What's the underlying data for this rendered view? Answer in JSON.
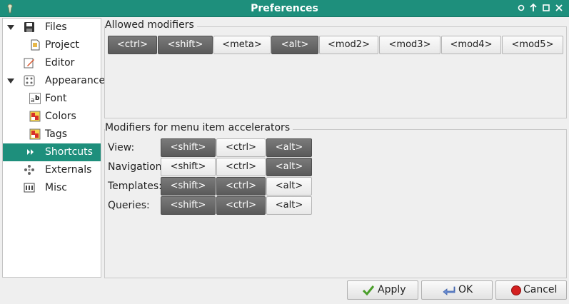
{
  "window": {
    "title": "Preferences",
    "controls": [
      "circle-icon",
      "up-arrow-icon",
      "maximize-icon",
      "close-icon"
    ]
  },
  "sidebar": {
    "items": [
      {
        "label": "Files",
        "icon": "floppy-disk-icon",
        "expanded": true
      },
      {
        "label": "Project",
        "icon": "project-document-icon"
      },
      {
        "label": "Editor",
        "icon": "pencil-edit-icon"
      },
      {
        "label": "Appearance",
        "icon": "appearance-icon",
        "expanded": true
      },
      {
        "label": "Font",
        "icon": "font-icon"
      },
      {
        "label": "Colors",
        "icon": "colors-icon"
      },
      {
        "label": "Tags",
        "icon": "tags-icon"
      },
      {
        "label": "Shortcuts",
        "icon": "fast-forward-icon",
        "selected": true
      },
      {
        "label": "Externals",
        "icon": "externals-icon"
      },
      {
        "label": "Misc",
        "icon": "misc-icon"
      }
    ]
  },
  "allowed_modifiers": {
    "title": "Allowed modifiers",
    "buttons": [
      {
        "label": "<ctrl>",
        "checked": true
      },
      {
        "label": "<shift>",
        "checked": true
      },
      {
        "label": "<meta>",
        "checked": false
      },
      {
        "label": "<alt>",
        "checked": true
      },
      {
        "label": "<mod2>",
        "checked": false
      },
      {
        "label": "<mod3>",
        "checked": false
      },
      {
        "label": "<mod4>",
        "checked": false
      },
      {
        "label": "<mod5>",
        "checked": false
      }
    ]
  },
  "accelerators": {
    "title": "Modifiers for menu item accelerators",
    "rows": [
      {
        "label": "View:",
        "buttons": [
          {
            "label": "<shift>",
            "checked": true
          },
          {
            "label": "<ctrl>",
            "checked": false
          },
          {
            "label": "<alt>",
            "checked": true
          }
        ]
      },
      {
        "label": "Navigation:",
        "buttons": [
          {
            "label": "<shift>",
            "checked": false
          },
          {
            "label": "<ctrl>",
            "checked": false
          },
          {
            "label": "<alt>",
            "checked": true
          }
        ]
      },
      {
        "label": "Templates:",
        "buttons": [
          {
            "label": "<shift>",
            "checked": true
          },
          {
            "label": "<ctrl>",
            "checked": true
          },
          {
            "label": "<alt>",
            "checked": false
          }
        ]
      },
      {
        "label": "Queries:",
        "buttons": [
          {
            "label": "<shift>",
            "checked": true
          },
          {
            "label": "<ctrl>",
            "checked": true
          },
          {
            "label": "<alt>",
            "checked": false
          }
        ]
      }
    ]
  },
  "footer": {
    "apply": "Apply",
    "ok": "OK",
    "cancel": "Cancel"
  },
  "colors": {
    "accent": "#1e8f7c",
    "toggle_on": "#666666",
    "toggle_off": "#f2f2f2"
  }
}
